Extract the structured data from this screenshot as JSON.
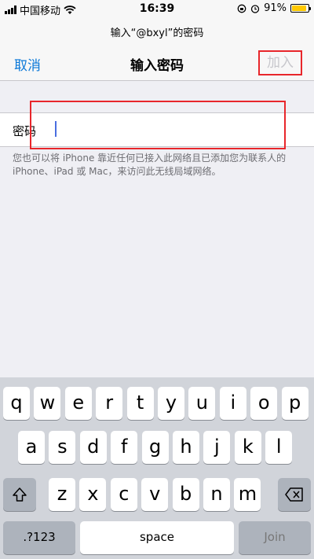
{
  "status": {
    "carrier": "中国移动",
    "time": "16:39",
    "battery": "91%",
    "battery_level": 0.91
  },
  "prompt": "输入“@bxyl”的密码",
  "nav": {
    "cancel": "取消",
    "title": "输入密码",
    "join": "加入"
  },
  "form": {
    "label": "密码",
    "value": "",
    "help": "您也可以将 iPhone 靠近任何已接入此网络且已添加您为联系人的 iPhone、iPad 或 Mac，来访问此无线局域网络。"
  },
  "keyboard": {
    "row1": [
      "q",
      "w",
      "e",
      "r",
      "t",
      "y",
      "u",
      "i",
      "o",
      "p"
    ],
    "row2": [
      "a",
      "s",
      "d",
      "f",
      "g",
      "h",
      "j",
      "k",
      "l"
    ],
    "row3": [
      "z",
      "x",
      "c",
      "v",
      "b",
      "n",
      "m"
    ],
    "numbers": ".?123",
    "space": "space",
    "join": "Join",
    "icons": {
      "shift": "shift-icon",
      "delete": "delete-icon"
    }
  },
  "colors": {
    "accent": "#0a78d8",
    "highlight": "#e8262b",
    "battery": "#ffc800"
  }
}
